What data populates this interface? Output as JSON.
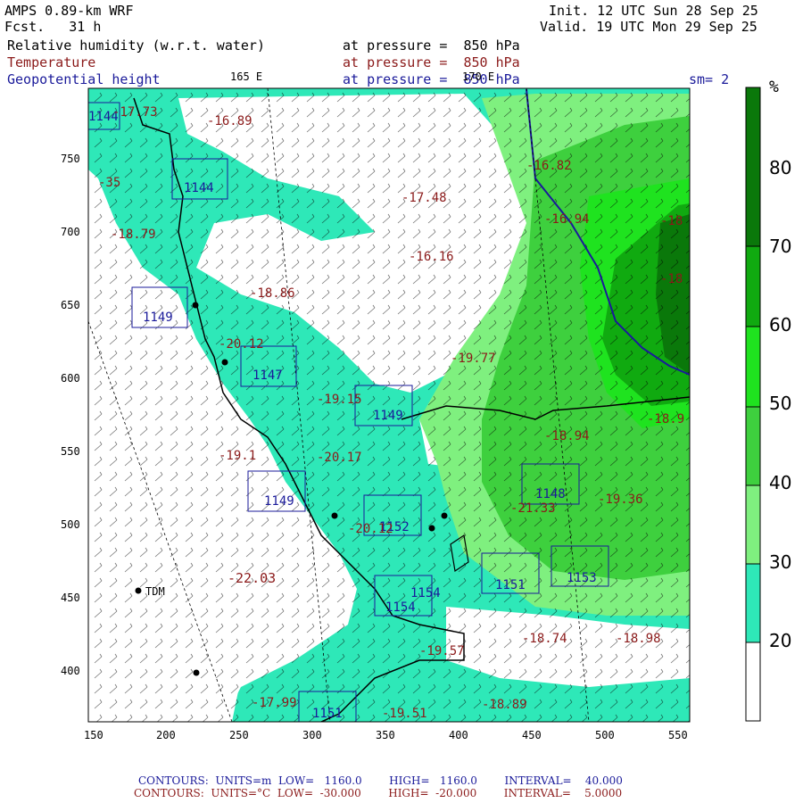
{
  "header": {
    "model": "AMPS 0.89-km WRF",
    "forecast": "Fcst.   31 h",
    "init": "Init. 12 UTC Sun 28 Sep 25",
    "valid": "Valid. 19 UTC Mon 29 Sep 25",
    "field1": "Relative humidity (w.r.t. water)",
    "field2": "Temperature",
    "field3": "Geopotential height",
    "pressure1": "at pressure =  850 hPa",
    "pressure2": "at pressure =  850 hPa",
    "pressure3": "at pressure =  850 hPa",
    "lon165": "165 E",
    "lon170": "170 E",
    "smoothing": "sm= 2"
  },
  "colors": {
    "rh_20": "#ffffff",
    "rh_30": "#2ee8b8",
    "rh_40": "#7ff07f",
    "rh_50": "#3ed03e",
    "rh_60": "#1fe31f",
    "rh_70": "#10aa10",
    "rh_80": "#0a780a",
    "height_contour": "#1a1a9a",
    "temp_contour": "#8b1a1a"
  },
  "colorbar": {
    "unit": "%",
    "labels": [
      "80",
      "70",
      "60",
      "50",
      "40",
      "30",
      "20"
    ]
  },
  "axes": {
    "x_ticks": [
      "150",
      "200",
      "250",
      "300",
      "350",
      "400",
      "450",
      "500",
      "550"
    ],
    "y_ticks": [
      "750",
      "700",
      "650",
      "600",
      "550",
      "500",
      "450",
      "400"
    ]
  },
  "station": {
    "label": "TDM"
  },
  "height_labels": [
    "1144",
    "1144",
    "1147",
    "1149",
    "1149",
    "1148",
    "1152",
    "1149",
    "1151",
    "1153",
    "1154",
    "1154",
    "1151"
  ],
  "temp_labels": [
    "-16.89",
    "-16.82",
    "-17.48",
    "-16.94",
    "-18.79",
    "-16.16",
    "-18.86",
    "-20.12",
    "-19.77",
    "-19.15",
    "-18.94",
    "-18.9",
    "-18",
    "-19.1",
    "-20.17",
    "-19.36",
    "-21.33",
    "-20.12",
    "-22.03",
    "-17.99",
    "-19.57",
    "-18.74",
    "-18.98",
    "-18.89",
    "-19.51",
    "-35",
    "-18",
    "-17.73"
  ],
  "footer": {
    "height_contours": "CONTOURS:  UNITS=m  LOW=   1160.0        HIGH=   1160.0        INTERVAL=    40.000",
    "temp_contours": "CONTOURS:  UNITS=°C  LOW=  -30.000        HIGH=  -20.000        INTERVAL=    5.0000"
  }
}
